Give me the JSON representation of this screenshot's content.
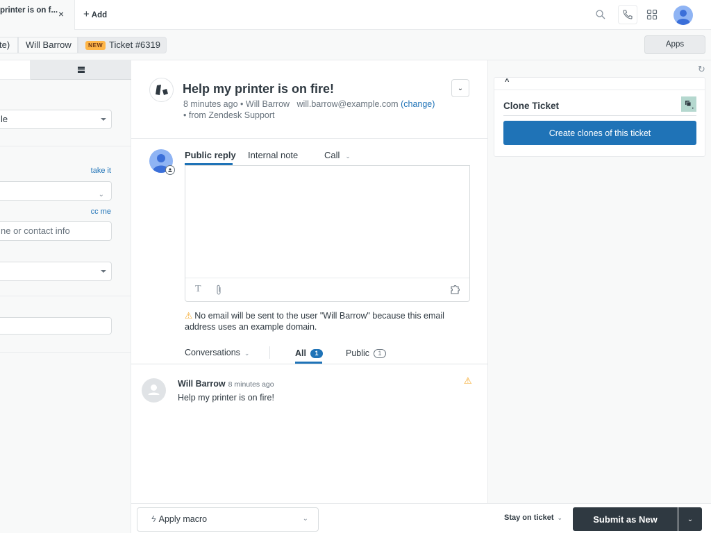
{
  "topbar": {
    "active_tab_title": "printer is on f...",
    "close_label": "×",
    "add_label": "Add",
    "icons": [
      "search-icon",
      "phone-icon",
      "grid-icon",
      "user-avatar-icon"
    ]
  },
  "breadcrumb": {
    "items": [
      "te)",
      "Will Barrow",
      "Ticket #6319"
    ],
    "status_badge": "NEW",
    "apps_button": "Apps"
  },
  "left_panel": {
    "select_1_value": "le",
    "take_it_link": "take it",
    "cc_me_link": "cc me",
    "cc_placeholder": "ne or contact info"
  },
  "ticket": {
    "title": "Help my printer is on fire!",
    "time_ago": "8 minutes ago",
    "requester": "Will Barrow",
    "email": "will.barrow@example.com",
    "change_link": "(change)",
    "source": "• from Zendesk Support",
    "separator": "•"
  },
  "composer": {
    "tabs": [
      "Public reply",
      "Internal note",
      "Call"
    ],
    "active_tab": "Public reply",
    "body_value": "",
    "warning": "No email will be sent to the user \"Will Barrow\" because this email address uses an example domain."
  },
  "conversation": {
    "filter_label": "Conversations",
    "tabs": [
      {
        "label": "All",
        "count": "1"
      },
      {
        "label": "Public",
        "count": "1"
      }
    ],
    "messages": [
      {
        "author": "Will Barrow",
        "time": "8 minutes ago",
        "body": "Help my printer is on fire!"
      }
    ]
  },
  "apps_panel": {
    "app_title": "Clone Ticket",
    "button_label": "Create clones of this ticket"
  },
  "footer": {
    "macro_label": "Apply macro",
    "stay_label": "Stay on ticket",
    "submit_label": "Submit as New"
  },
  "colors": {
    "accent": "#1f73b7",
    "submit": "#2f3941",
    "badge_new": "#ffb648",
    "warning": "#f5a623"
  }
}
